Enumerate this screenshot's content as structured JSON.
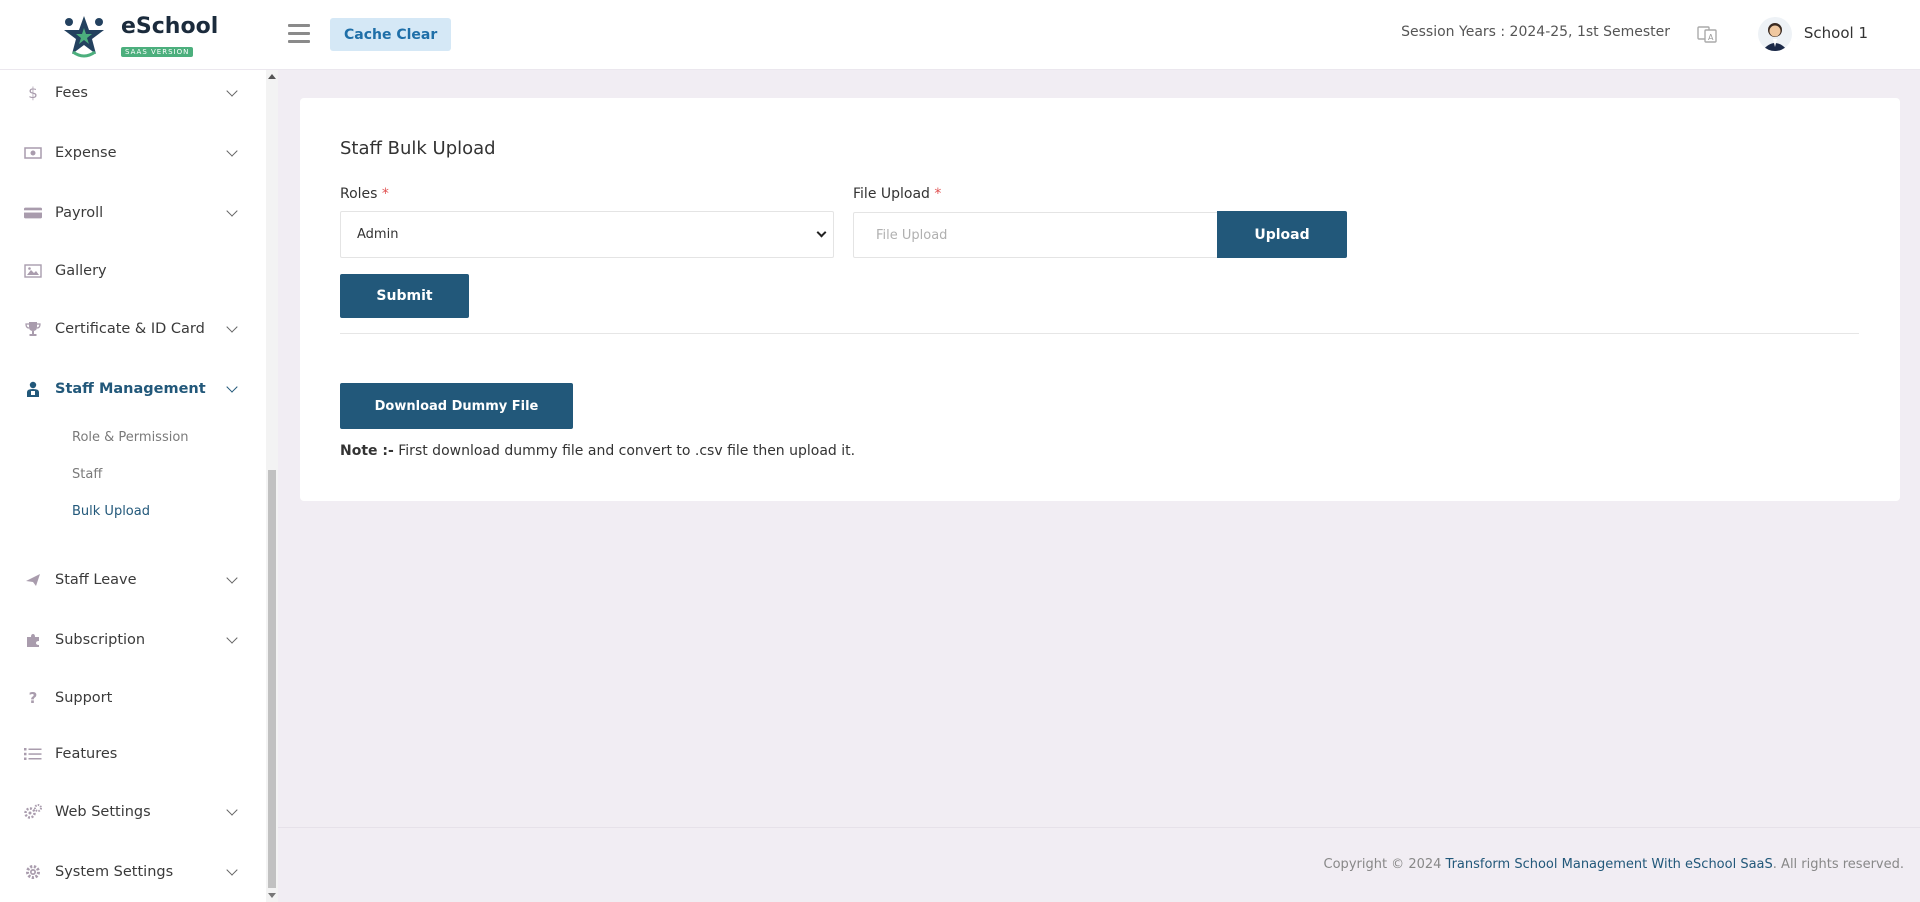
{
  "header": {
    "logo_title": "eSchool",
    "logo_badge": "SAAS VERSION",
    "cache_clear_label": "Cache Clear",
    "session_text": "Session Years : 2024-25, 1st Semester",
    "user_name": "School 1"
  },
  "sidebar": {
    "items": [
      {
        "label": "Fees",
        "icon": "dollar-icon"
      },
      {
        "label": "Expense",
        "icon": "money-icon"
      },
      {
        "label": "Payroll",
        "icon": "credit-card-icon"
      },
      {
        "label": "Gallery",
        "icon": "image-icon"
      },
      {
        "label": "Certificate & ID Card",
        "icon": "trophy-icon"
      },
      {
        "label": "Staff Management",
        "icon": "staff-icon"
      },
      {
        "label": "Staff Leave",
        "icon": "plane-icon"
      },
      {
        "label": "Subscription",
        "icon": "puzzle-icon"
      },
      {
        "label": "Support",
        "icon": "question-icon"
      },
      {
        "label": "Features",
        "icon": "list-icon"
      },
      {
        "label": "Web Settings",
        "icon": "cogs-icon"
      },
      {
        "label": "System Settings",
        "icon": "gear-icon"
      }
    ],
    "sub_items": [
      "Role & Permission",
      "Staff",
      "Bulk Upload"
    ]
  },
  "main": {
    "title": "Staff Bulk Upload",
    "roles_label": "Roles",
    "required_mark": "*",
    "roles_selected": "Admin",
    "file_upload_label": "File Upload",
    "file_upload_placeholder": "File Upload",
    "upload_label": "Upload",
    "submit_label": "Submit",
    "download_label": "Download Dummy File",
    "note_prefix": "Note :-",
    "note_text": " First download dummy file and convert to .csv file then upload it."
  },
  "footer": {
    "copyright": "Copyright © 2024 ",
    "link": "Transform School Management With eSchool SaaS",
    "suffix": ". All rights reserved."
  },
  "colors": {
    "primary": "#22587a",
    "background": "#f1edf3",
    "cache_bg": "#d5e8f6",
    "icon_muted": "#a99cad"
  }
}
